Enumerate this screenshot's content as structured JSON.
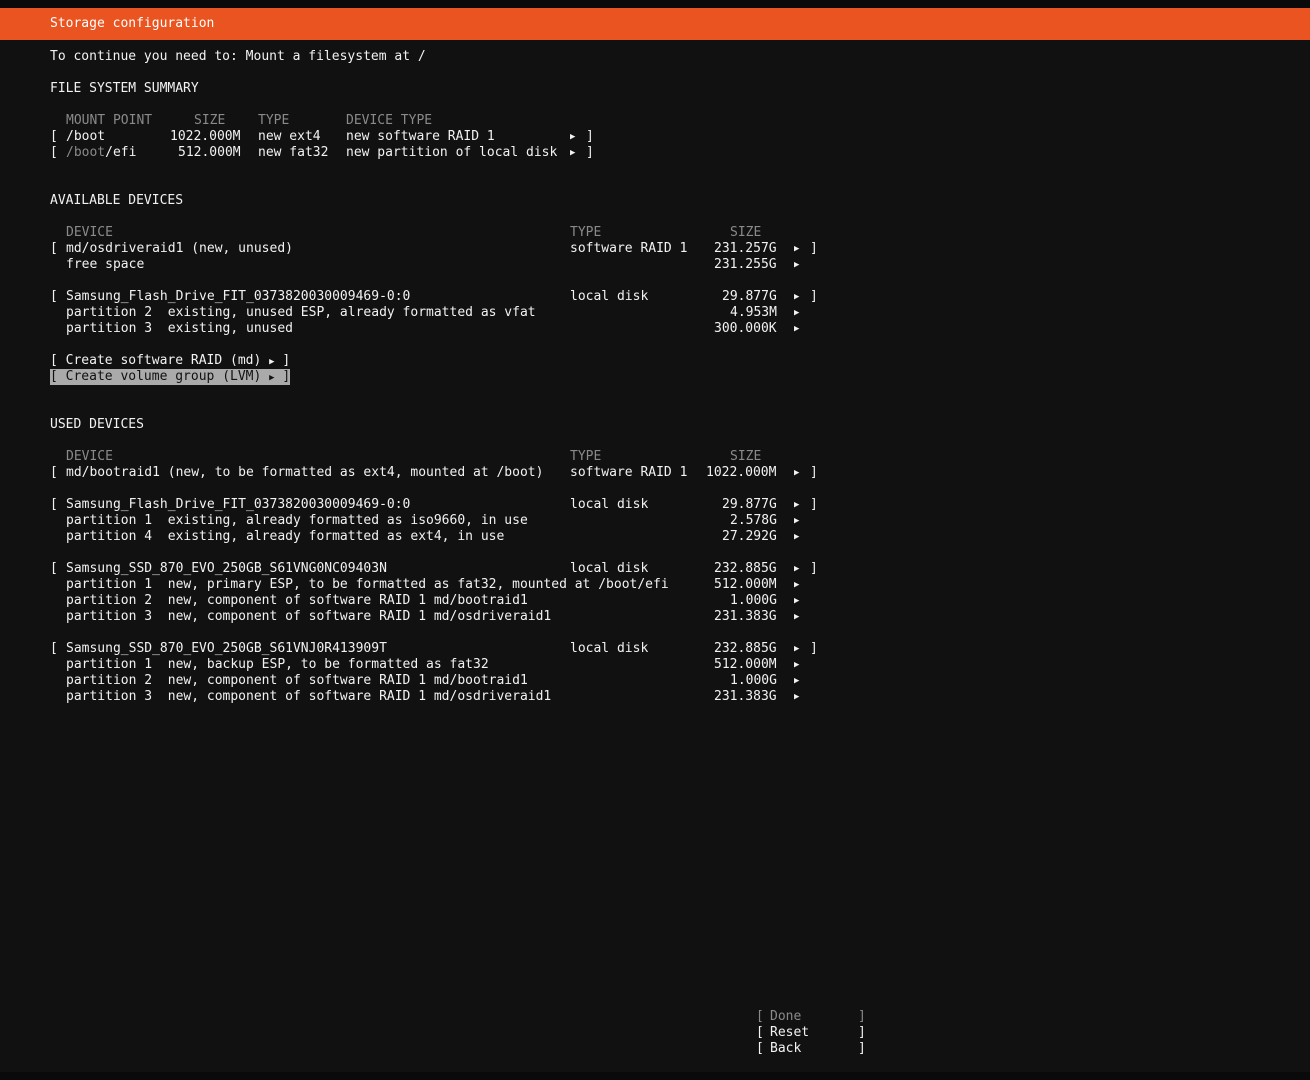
{
  "title": "Storage configuration",
  "instruction": "To continue you need to: Mount a filesystem at /",
  "fs_summary": {
    "heading": "FILE SYSTEM SUMMARY",
    "headers": [
      "MOUNT POINT",
      "SIZE",
      "TYPE",
      "DEVICE TYPE"
    ],
    "rows": [
      {
        "mount_prefix": "",
        "mount_main": "/boot",
        "size": "1022.000M",
        "type": "new ext4",
        "device_type": "new software RAID 1"
      },
      {
        "mount_prefix": "/boot",
        "mount_main": "/efi",
        "size": "512.000M",
        "type": "new fat32",
        "device_type": "new partition of local disk"
      }
    ]
  },
  "available": {
    "heading": "AVAILABLE DEVICES",
    "headers": [
      "DEVICE",
      "TYPE",
      "SIZE"
    ],
    "rows": [
      {
        "bracket": true,
        "name": "md/osdriveraid1 (new, unused)",
        "type": "software RAID 1",
        "size": "231.257G"
      },
      {
        "bracket": false,
        "name": "free space",
        "type": "",
        "size": "231.255G"
      },
      {
        "bracket": true,
        "name": "Samsung_Flash_Drive_FIT_0373820030009469-0:0",
        "type": "local disk",
        "size": "29.877G"
      },
      {
        "bracket": false,
        "name": "partition 2  existing, unused ESP, already formatted as vfat",
        "type": "",
        "size": "4.953M"
      },
      {
        "bracket": false,
        "name": "partition 3  existing, unused",
        "type": "",
        "size": "300.000K"
      }
    ],
    "create_raid": "Create software RAID (md)",
    "create_lvm": "Create volume group (LVM)"
  },
  "used": {
    "heading": "USED DEVICES",
    "headers": [
      "DEVICE",
      "TYPE",
      "SIZE"
    ],
    "rows": [
      {
        "bracket": true,
        "name": "md/bootraid1 (new, to be formatted as ext4, mounted at /boot)",
        "type": "software RAID 1",
        "size": "1022.000M"
      },
      {
        "bracket": true,
        "name": "Samsung_Flash_Drive_FIT_0373820030009469-0:0",
        "type": "local disk",
        "size": "29.877G"
      },
      {
        "bracket": false,
        "name": "partition 1  existing, already formatted as iso9660, in use",
        "type": "",
        "size": "2.578G"
      },
      {
        "bracket": false,
        "name": "partition 4  existing, already formatted as ext4, in use",
        "type": "",
        "size": "27.292G"
      },
      {
        "bracket": true,
        "name": "Samsung_SSD_870_EVO_250GB_S61VNG0NC09403N",
        "type": "local disk",
        "size": "232.885G"
      },
      {
        "bracket": false,
        "name": "partition 1  new, primary ESP, to be formatted as fat32, mounted at /boot/efi",
        "type": "",
        "size": "512.000M"
      },
      {
        "bracket": false,
        "name": "partition 2  new, component of software RAID 1 md/bootraid1",
        "type": "",
        "size": "1.000G"
      },
      {
        "bracket": false,
        "name": "partition 3  new, component of software RAID 1 md/osdriveraid1",
        "type": "",
        "size": "231.383G"
      },
      {
        "bracket": true,
        "name": "Samsung_SSD_870_EVO_250GB_S61VNJ0R413909T",
        "type": "local disk",
        "size": "232.885G"
      },
      {
        "bracket": false,
        "name": "partition 1  new, backup ESP, to be formatted as fat32",
        "type": "",
        "size": "512.000M"
      },
      {
        "bracket": false,
        "name": "partition 2  new, component of software RAID 1 md/bootraid1",
        "type": "",
        "size": "1.000G"
      },
      {
        "bracket": false,
        "name": "partition 3  new, component of software RAID 1 md/osdriveraid1",
        "type": "",
        "size": "231.383G"
      }
    ]
  },
  "buttons": {
    "done": "Done",
    "reset": "Reset",
    "back": "Back"
  }
}
